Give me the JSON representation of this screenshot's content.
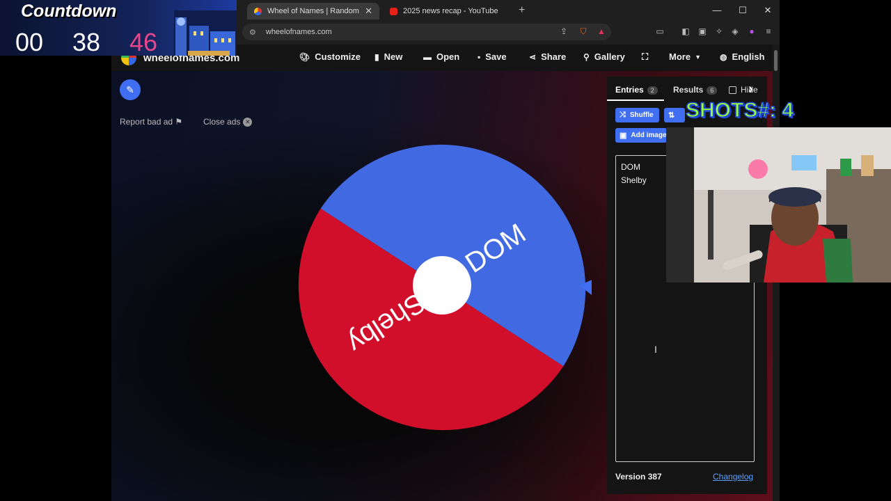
{
  "countdown": {
    "title": "Countdown",
    "hours": "00",
    "minutes": "38",
    "seconds": "46"
  },
  "overlay": {
    "shots_label": "SHOTS#: 4"
  },
  "browser": {
    "tabs": [
      {
        "title": "Wheel of Names | Random name picker",
        "active": true
      },
      {
        "title": "2025 news recap - YouTube",
        "active": false
      }
    ],
    "url": "wheelofnames.com"
  },
  "site": {
    "logo_text": "wheelofnames.com",
    "nav": {
      "customize": "Customize",
      "new": "New",
      "open": "Open",
      "save": "Save",
      "share": "Share",
      "gallery": "Gallery",
      "more": "More",
      "language": "English"
    },
    "report_bad_ad": "Report bad ad",
    "close_ads": "Close ads"
  },
  "wheel": {
    "segments": [
      {
        "label": "DOM",
        "color": "#4169e1"
      },
      {
        "label": "Shelby",
        "color": "#d10f2a"
      }
    ],
    "center_color": "#ffffff",
    "pointer_color": "#3f6ef0"
  },
  "panel": {
    "tabs": {
      "entries": "Entries",
      "entries_count": "2",
      "results": "Results",
      "results_count": "6",
      "hide": "Hide"
    },
    "buttons": {
      "shuffle": "Shuffle",
      "add_image": "Add image"
    },
    "entries": [
      "DOM",
      "Shelby"
    ],
    "version": "Version 387",
    "changelog": "Changelog"
  },
  "colors": {
    "accent": "#3f6ef0",
    "wheel_blue": "#4169e1",
    "wheel_red": "#d10f2a",
    "shots_green": "#9cff3a"
  }
}
